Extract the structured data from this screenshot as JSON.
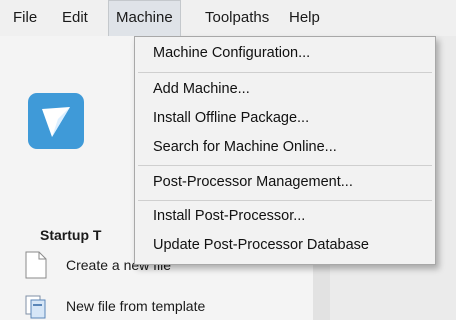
{
  "menubar": {
    "items": [
      {
        "label": "File"
      },
      {
        "label": "Edit"
      },
      {
        "label": "Machine"
      },
      {
        "label": "Toolpaths"
      },
      {
        "label": "Help"
      }
    ]
  },
  "machine_menu": {
    "items": [
      {
        "label": "Machine Configuration..."
      },
      {
        "label": "Add Machine..."
      },
      {
        "label": "Install Offline Package..."
      },
      {
        "label": "Search for Machine Online..."
      },
      {
        "label": "Post-Processor Management..."
      },
      {
        "label": "Install Post-Processor..."
      },
      {
        "label": "Update Post-Processor Database"
      }
    ]
  },
  "startup": {
    "heading": "Startup T",
    "tasks": [
      {
        "label": "Create a new file",
        "icon": "new-file-icon"
      },
      {
        "label": "New file from template",
        "icon": "template-icon"
      }
    ]
  },
  "colors": {
    "logo_bg": "#3f9ad8",
    "menu_active_bg": "#dfe3e8"
  }
}
